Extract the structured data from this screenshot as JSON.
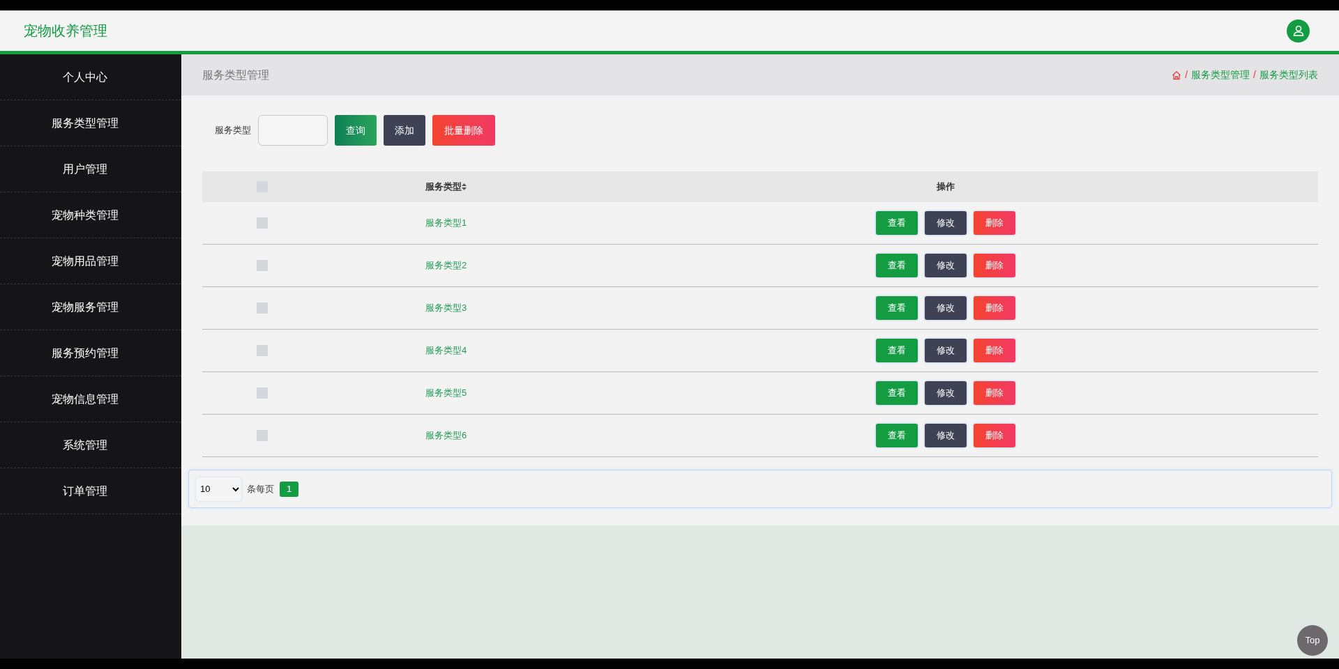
{
  "header": {
    "title": "宠物收养管理"
  },
  "sidebar": {
    "items": [
      {
        "label": "个人中心",
        "selected": false
      },
      {
        "label": "服务类型管理",
        "selected": false
      },
      {
        "label": "用户管理",
        "selected": false
      },
      {
        "label": "宠物种类管理",
        "selected": false
      },
      {
        "label": "宠物用品管理",
        "selected": false
      },
      {
        "label": "宠物服务管理",
        "selected": false
      },
      {
        "label": "服务预约管理",
        "selected": false
      },
      {
        "label": "宠物信息管理",
        "selected": false
      },
      {
        "label": "系统管理",
        "selected": false
      },
      {
        "label": "订单管理",
        "selected": false
      }
    ]
  },
  "page_title": "服务类型管理",
  "breadcrumb": [
    {
      "separator": "/",
      "label": "服务类型管理"
    },
    {
      "separator": "/",
      "label": "服务类型列表"
    }
  ],
  "filter": {
    "label": "服务类型",
    "buttons": [
      {
        "label": "查询",
        "kind": "query"
      },
      {
        "label": "添加",
        "kind": "add"
      },
      {
        "label": "批量删除",
        "kind": "delete"
      }
    ]
  },
  "table": {
    "header_checked": false,
    "columns": [
      "服务类型",
      "操作"
    ],
    "rows": [
      {
        "checked": false,
        "name": "服务类型1",
        "actions": [
          "查看",
          "修改",
          "删除"
        ]
      },
      {
        "checked": false,
        "name": "服务类型2",
        "actions": [
          "查看",
          "修改",
          "删除"
        ]
      },
      {
        "checked": false,
        "name": "服务类型3",
        "actions": [
          "查看",
          "修改",
          "删除"
        ]
      },
      {
        "checked": false,
        "name": "服务类型4",
        "actions": [
          "查看",
          "修改",
          "删除"
        ]
      },
      {
        "checked": false,
        "name": "服务类型5",
        "actions": [
          "查看",
          "修改",
          "删除"
        ]
      },
      {
        "checked": false,
        "name": "服务类型6",
        "actions": [
          "查看",
          "修改",
          "删除"
        ]
      }
    ]
  },
  "pagination": {
    "page_size": "10",
    "label": "条每页",
    "pages": [
      {
        "label": "1",
        "selected": true
      }
    ]
  },
  "back_to_top": "Top"
}
